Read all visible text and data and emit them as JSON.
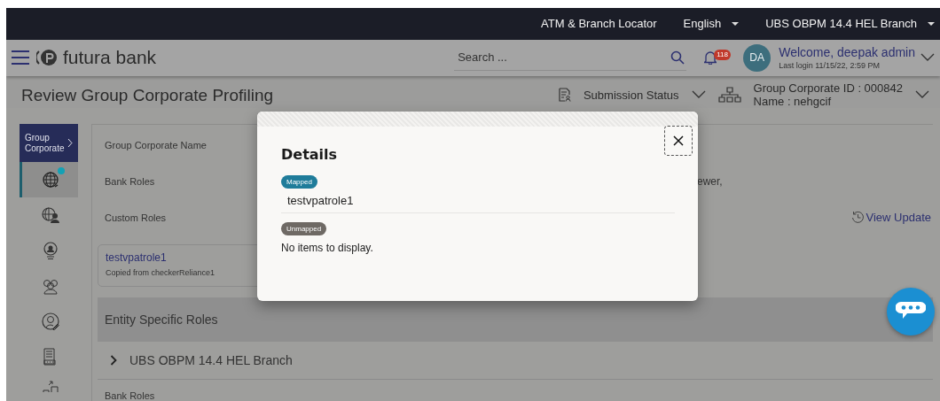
{
  "top_bar": {
    "links": [
      {
        "label": "ATM & Branch Locator",
        "dropdown": false
      },
      {
        "label": "English",
        "dropdown": true
      },
      {
        "label": "UBS OBPM 14.4 HEL Branch",
        "dropdown": true
      }
    ]
  },
  "header": {
    "logo": "futura bank",
    "search": {
      "placeholder": "Search ..."
    },
    "notification_count": "118",
    "avatar": "DA",
    "welcome": "Welcome, deepak admin",
    "last_login": "Last login 11/15/22, 2:59 PM"
  },
  "page": {
    "title": "Review Group Corporate Profiling",
    "submission_status": "Submission Status",
    "group_corporate_id": "Group Corporate ID : 000842",
    "name": "Name : nehgcif"
  },
  "sidebar": {
    "title": "Group Corporate",
    "items": [
      {
        "kind": "globe",
        "selected": true,
        "badge": true
      },
      {
        "kind": "globe-user",
        "selected": false,
        "badge": false
      },
      {
        "kind": "user-badge",
        "selected": false,
        "badge": false
      },
      {
        "kind": "group",
        "selected": false,
        "badge": false
      },
      {
        "kind": "user-edit",
        "selected": false,
        "badge": false
      },
      {
        "kind": "document",
        "selected": false,
        "badge": false
      },
      {
        "kind": "transfer",
        "selected": false,
        "badge": false
      }
    ]
  },
  "profile": {
    "fields": [
      {
        "label": "Group Corporate Name"
      },
      {
        "label": "Bank Roles",
        "value": "ewer,"
      },
      {
        "label": "Custom Roles"
      }
    ],
    "view_update": "View Update",
    "custom_role": {
      "name": "testvpatrole1",
      "description": "Copied from checkerReliance1"
    },
    "entity_section": "Entity Specific Roles",
    "entities": [
      {
        "label": "UBS OBPM 14.4 HEL Branch",
        "expanded": false
      }
    ],
    "next_label": "Bank Roles"
  },
  "modal": {
    "title": "Details",
    "sections": [
      {
        "tag": "Mapped",
        "color": "#1f7c9a",
        "items": [
          "testvpatrole1"
        ]
      },
      {
        "tag": "Unmapped",
        "color": "#6e6964",
        "empty_text": "No items to display."
      }
    ]
  }
}
